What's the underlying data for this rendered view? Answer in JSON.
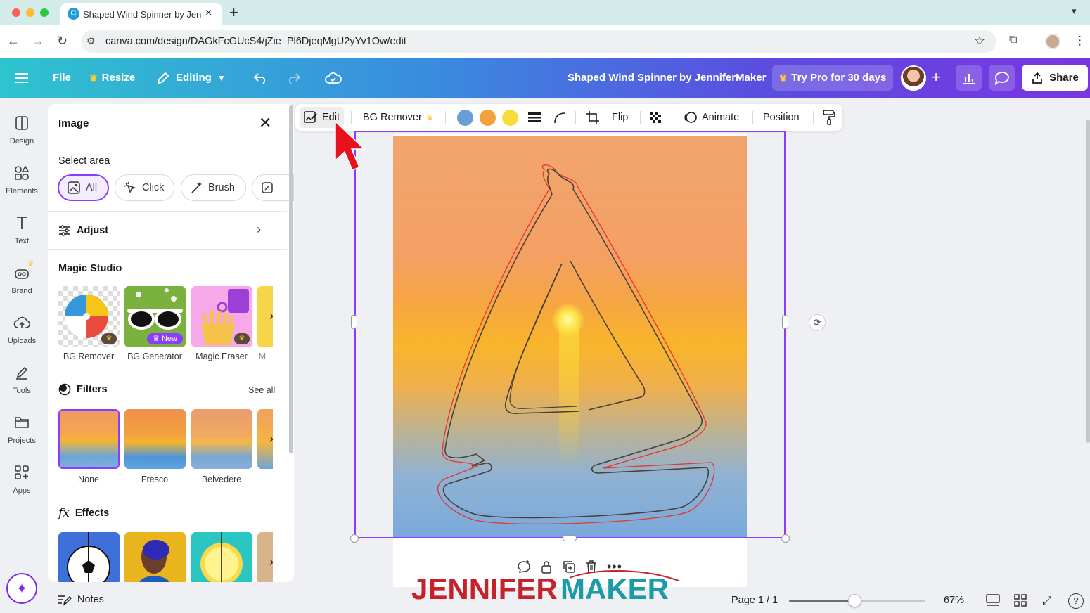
{
  "browser": {
    "tab_title": "Shaped Wind Spinner by Jen",
    "tab_favicon": "C",
    "url": "canva.com/design/DAGkFcGUcS4/jZie_Pl6DjeqMgU2yYv1Ow/edit"
  },
  "header": {
    "file": "File",
    "resize": "Resize",
    "editing": "Editing",
    "design_title": "Shaped Wind Spinner by JenniferMaker",
    "try_pro": "Try Pro for 30 days",
    "share": "Share",
    "crown_color": "#ffc93c"
  },
  "rail": {
    "items": [
      "Design",
      "Elements",
      "Text",
      "Brand",
      "Uploads",
      "Tools",
      "Projects",
      "Apps"
    ]
  },
  "panel": {
    "title": "Image",
    "select_area": "Select area",
    "chips": [
      "All",
      "Click",
      "Brush"
    ],
    "adjust": "Adjust",
    "magic_studio": "Magic Studio",
    "magic_items": [
      "BG Remover",
      "BG Generator",
      "Magic Eraser",
      "M"
    ],
    "new_badge": "New",
    "filters": "Filters",
    "see_all": "See all",
    "filter_items": [
      "None",
      "Fresco",
      "Belvedere"
    ],
    "effects": "Effects",
    "effects_icon": "fx"
  },
  "toolbar": {
    "edit": "Edit",
    "bg_remover": "BG Remover",
    "swatch_colors": [
      "#6a9fd6",
      "#f4a13a",
      "#f9dc3a"
    ],
    "flip": "Flip",
    "animate": "Animate",
    "position": "Position"
  },
  "canvas": {
    "watermark_left": "JENNIFER",
    "watermark_right": "MAKER",
    "watermark_left_color": "#c4232c",
    "watermark_right_color": "#1d9aa8",
    "selection_color": "#8b3dff"
  },
  "footer": {
    "notes": "Notes",
    "page": "Page 1 / 1",
    "zoom": "67%",
    "zoom_fraction": 0.48
  }
}
